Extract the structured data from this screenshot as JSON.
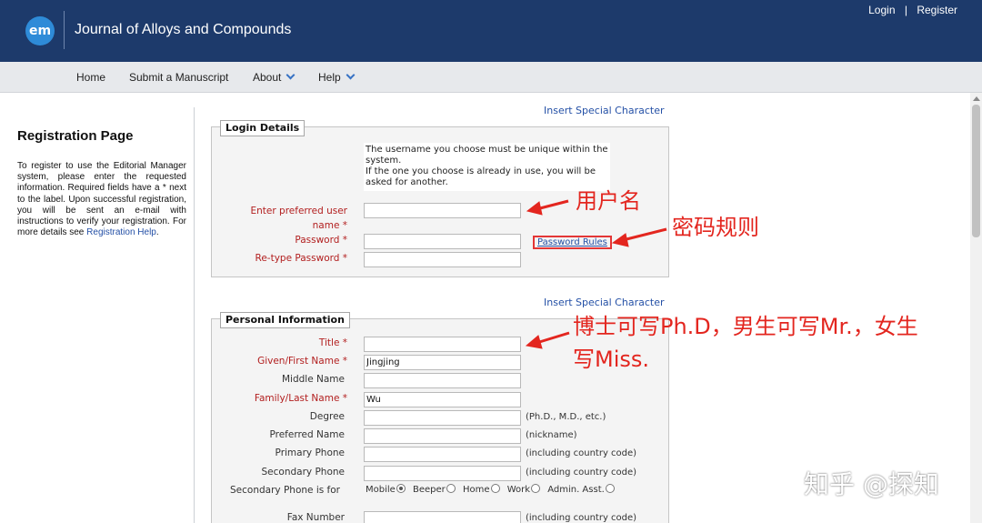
{
  "header": {
    "logo_text": "em",
    "journal_title": "Journal of Alloys and Compounds",
    "login_label": "Login",
    "separator": "|",
    "register_label": "Register",
    "background": "#1d3a6b",
    "logo_color": "#2e8bd8"
  },
  "nav": {
    "home_label": "Home",
    "submit_label": "Submit a Manuscript",
    "about_label": "About",
    "help_label": "Help"
  },
  "sidebar": {
    "title": "Registration Page",
    "text": "To register to use the Editorial Manager system, please enter the requested information. Required fields have a * next to the label. Upon successful registration, you will be sent an e-mail with instructions to verify your registration. For more details see",
    "link_label": "Registration Help",
    "link_suffix": "."
  },
  "special_character_label": "Insert Special Character",
  "login_details": {
    "title": "Login Details",
    "info_line1": "The username you choose must be unique within the system.",
    "info_line2": "If the one you choose is already in use, you will be asked for another.",
    "username_label_line1": "Enter preferred user",
    "username_label_line2": "name *",
    "password_label": "Password *",
    "retype_label": "Re-type Password *",
    "password_rules_label": "Password Rules",
    "username_value": "",
    "password_value": "",
    "retype_value": ""
  },
  "personal_information": {
    "title": "Personal Information",
    "fields": [
      {
        "label": "Title *",
        "value": ""
      },
      {
        "label": "Given/First Name *",
        "value": "Jingjing"
      },
      {
        "label": "Middle Name",
        "value": ""
      },
      {
        "label": "Family/Last Name *",
        "value": "Wu"
      },
      {
        "label": "Degree",
        "value": "",
        "hint": "(Ph.D., M.D., etc.)"
      },
      {
        "label": "Preferred Name",
        "value": "",
        "hint": "(nickname)"
      },
      {
        "label": "Primary Phone",
        "value": "",
        "hint": "(including country code)"
      },
      {
        "label": "Secondary Phone",
        "value": "",
        "hint": "(including country code)"
      },
      {
        "label": "Fax Number",
        "value": "",
        "hint": "(including country code)"
      }
    ],
    "secondary_phone_type_label": "Secondary Phone is for",
    "secondary_phone_options": [
      {
        "label": "Mobile",
        "selected": true
      },
      {
        "label": "Beeper",
        "selected": false
      },
      {
        "label": "Home",
        "selected": false
      },
      {
        "label": "Work",
        "selected": false
      },
      {
        "label": "Admin. Asst.",
        "selected": false
      }
    ]
  },
  "annotations": {
    "username": "用户名",
    "password_rules": "密码规则",
    "title_line1": "博士可写Ph.D，男生可写Mr.，女生",
    "title_line2": "写Miss.",
    "color": "#e3261f"
  },
  "watermark": "知乎 @探知",
  "icons": {
    "arrow_down": "chevron-down-icon",
    "radio": "radio-button-icon",
    "scroll_up": "scroll-up-icon"
  }
}
